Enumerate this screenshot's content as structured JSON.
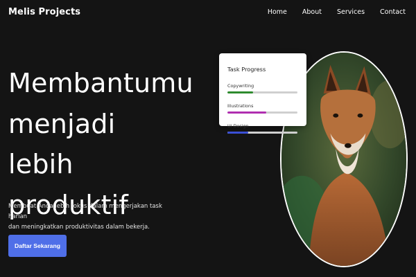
{
  "nav": {
    "brand": "Melis Projects",
    "links": [
      "Home",
      "About",
      "Services",
      "Contact"
    ]
  },
  "hero": {
    "title_lines": [
      "Membantumu",
      "menjadi lebih",
      "produktif"
    ],
    "description_lines": [
      "Membuat Anda lebih fokus dalam mengerjakan task harian",
      "dan meningkatkan produktivitas dalam bekerja."
    ],
    "cta_label": "Daftar Sekarang"
  },
  "task_card": {
    "title": "Task Progress",
    "tasks": [
      {
        "label": "Copywriting",
        "progress": 0.37,
        "color": "#2e8b2e"
      },
      {
        "label": "Illustrations",
        "progress": 0.55,
        "color": "#b02eb0"
      },
      {
        "label": "Ui Design",
        "progress": 0.3,
        "color": "#3a4fd6"
      }
    ]
  },
  "colors": {
    "background": "#141414",
    "accent": "#4f6fe8"
  }
}
